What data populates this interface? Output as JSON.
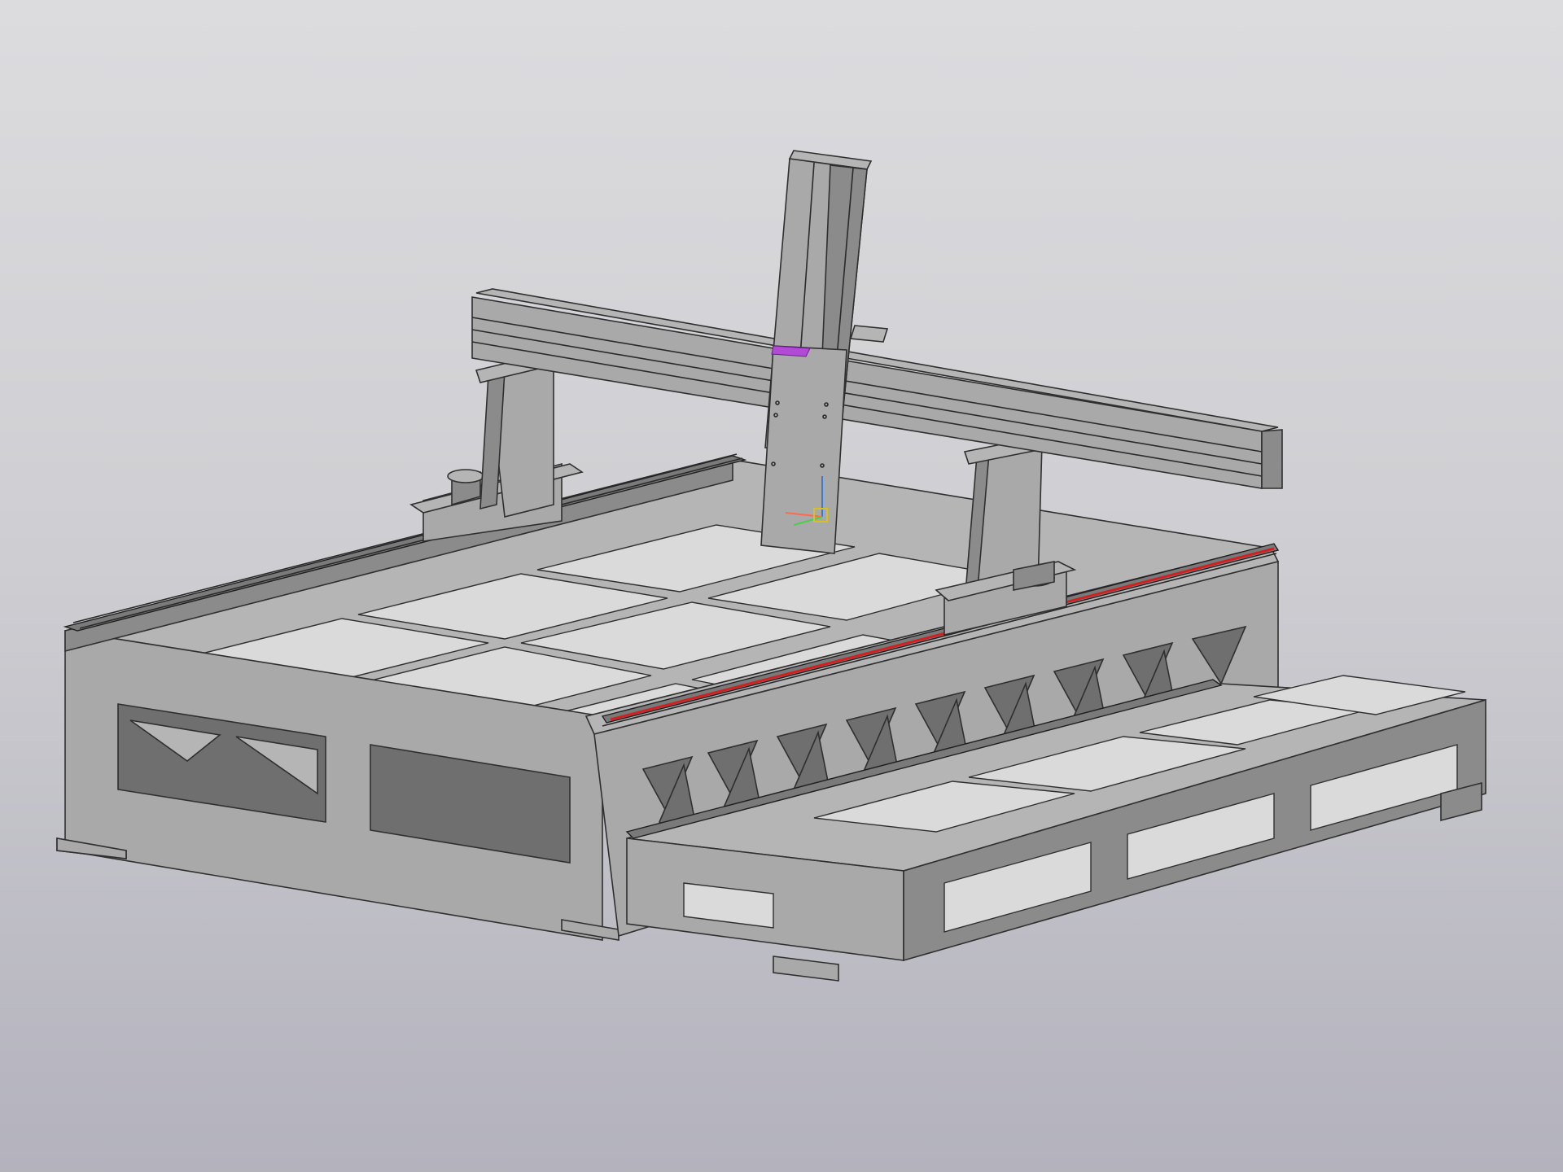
{
  "viewport": {
    "background_top": "#dcdcdf",
    "background_bottom": "#b3b2bd"
  },
  "model": {
    "colors": {
      "frame_light": "#b5b5b5",
      "frame_mid": "#8b8b8b",
      "frame_dark": "#6f6f6f",
      "edges": "#2f2f2f",
      "highlight_rail": "#d22020",
      "selection_marker": "#b24ad6"
    },
    "triad": {
      "x_axis_color": "#ff6a4a",
      "y_axis_color": "#4ad04a",
      "z_axis_color": "#3a7ad6",
      "origin_box_color": "#d8c020"
    }
  }
}
